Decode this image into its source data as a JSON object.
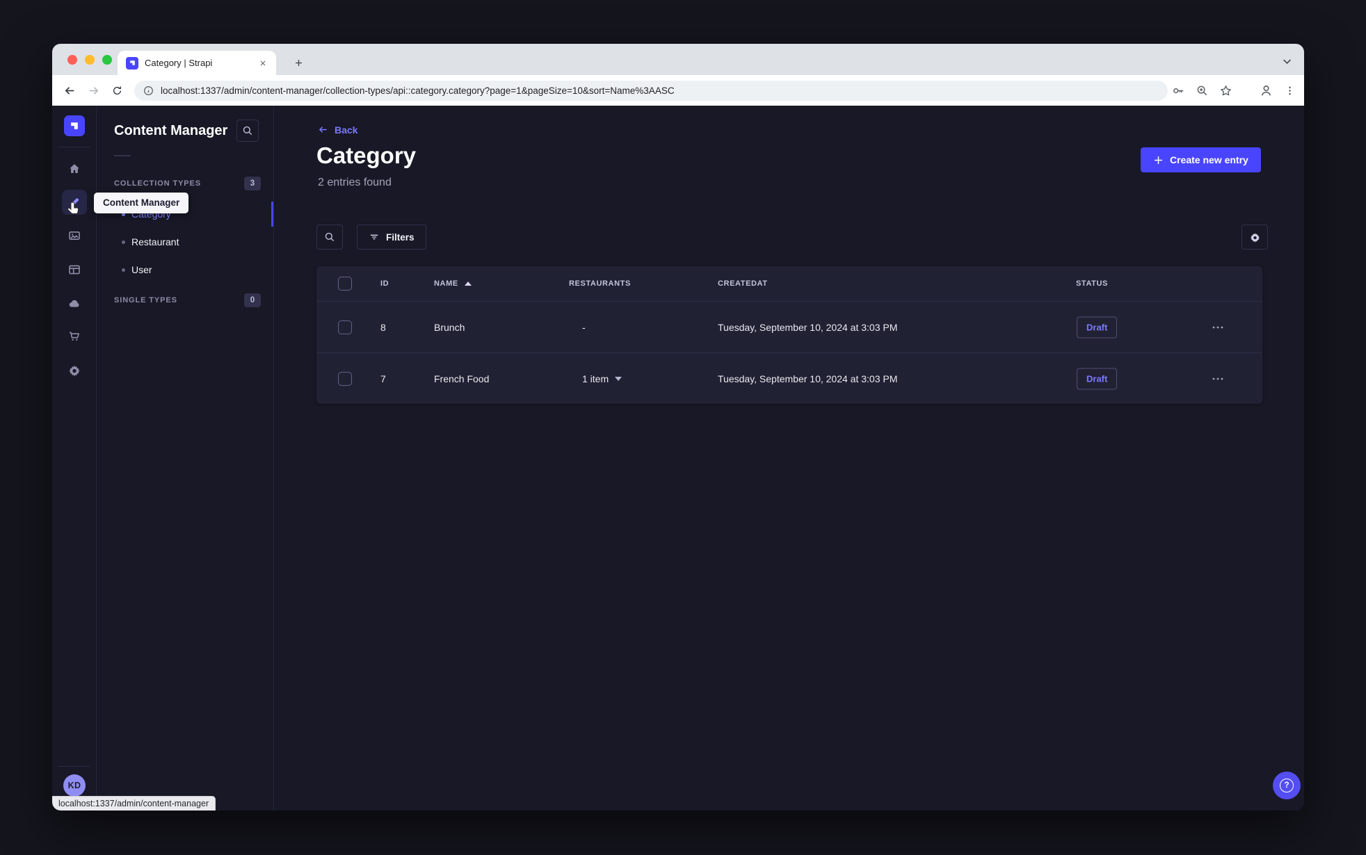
{
  "window": {
    "tab_title": "Category | Strapi",
    "url": "localhost:1337/admin/content-manager/collection-types/api::category.category?page=1&pageSize=10&sort=Name%3AASC",
    "status_bar_link": "localhost:1337/admin/content-manager"
  },
  "sidebar": {
    "icon_names": [
      "strapi-logo",
      "home",
      "content-manager",
      "media-library",
      "content-type-builder",
      "cloud",
      "marketplace",
      "settings"
    ],
    "avatar_initials": "KD"
  },
  "subnav": {
    "title": "Content Manager",
    "tooltip": "Content Manager",
    "collection_types": {
      "label": "COLLECTION TYPES",
      "badge": "3",
      "items": [
        {
          "label": "Category",
          "active": true
        },
        {
          "label": "Restaurant",
          "active": false
        },
        {
          "label": "User",
          "active": false
        }
      ]
    },
    "single_types": {
      "label": "SINGLE TYPES",
      "badge": "0"
    }
  },
  "main": {
    "back_label": "Back",
    "title": "Category",
    "subtitle": "2 entries found",
    "create_button": "Create new entry",
    "filters_button": "Filters",
    "table": {
      "headers": {
        "id": "ID",
        "name": "NAME",
        "restaurants": "RESTAURANTS",
        "createdat": "CREATEDAT",
        "status": "STATUS"
      },
      "sort_column": "NAME",
      "sort_direction": "ascending",
      "rows": [
        {
          "id": "8",
          "name": "Brunch",
          "restaurants": "-",
          "createdat": "Tuesday, September 10, 2024 at 3:03 PM",
          "status": "Draft"
        },
        {
          "id": "7",
          "name": "French Food",
          "restaurants": "1 item",
          "createdat": "Tuesday, September 10, 2024 at 3:03 PM",
          "status": "Draft"
        }
      ]
    }
  },
  "help": {
    "label": "?"
  },
  "colors": {
    "primary": "#4945ff",
    "primary_light": "#7b79ff",
    "app_background": "#181826",
    "card_background": "#212134",
    "border": "#32324d",
    "text_muted": "#a5a5ba",
    "draft_status": "#7b79ff",
    "avatar": "#908df2"
  }
}
